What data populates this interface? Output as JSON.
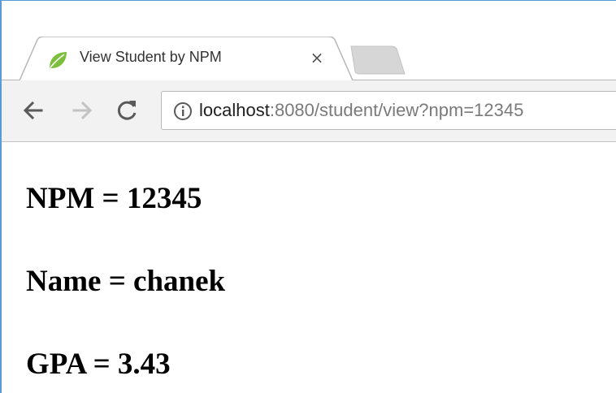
{
  "browser": {
    "tab": {
      "title": "View Student by NPM",
      "close_glyph": "×",
      "favicon": "spring-leaf-icon",
      "favicon_color": "#6db33f"
    },
    "toolbar": {
      "back_icon": "back-arrow-icon",
      "forward_icon": "forward-arrow-icon",
      "reload_icon": "reload-icon"
    },
    "address_bar": {
      "host": "localhost",
      "rest": ":8080/student/view?npm=12345",
      "info_icon": "info-icon"
    }
  },
  "page": {
    "npm_line": "NPM = 12345",
    "name_line": "Name = chanek",
    "gpa_line": "GPA = 3.43"
  },
  "colors": {
    "window_border": "#5a9bd5",
    "toolbar_bg": "#f2f2f2",
    "text": "#000000"
  }
}
